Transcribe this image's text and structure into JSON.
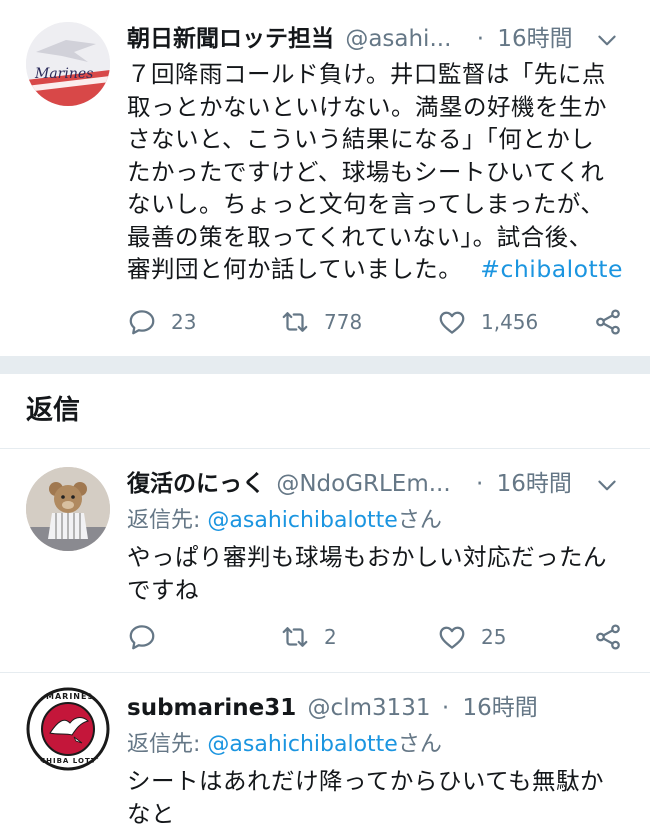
{
  "main_tweet": {
    "name": "朝日新聞ロッテ担当",
    "handle": "@asahi...",
    "separator": "·",
    "time": "16時間",
    "avatar_text": "Marines",
    "text_lines": [
      "７回降雨コールド負け。井口監督は「先に点",
      "取っとかないといけない。満塁の好機を生か",
      "さないと、こういう結果になる」「何とかし",
      "たかったですけど、球場もシートひいてくれ",
      "ないし。ちょっと文句を言ってしまったが、",
      "最善の策を取ってくれていない」。試合後、",
      "審判団と何か話していました。"
    ],
    "hashtag": "#chibalotte",
    "replies_count": "23",
    "retweets_count": "778",
    "likes_count": "1,456"
  },
  "section": {
    "title": "返信"
  },
  "reply1": {
    "name": "復活のにっく",
    "handle": "@NdoGRLEm...",
    "separator": "·",
    "time": "16時間",
    "reply_to_prefix": "返信先: ",
    "reply_to_handle": "@asahichibalotte",
    "reply_to_suffix": "さん",
    "text_lines": [
      "やっぱり審判も球場もおかしい対応だったん",
      "ですね"
    ],
    "replies_count": "",
    "retweets_count": "2",
    "likes_count": "25"
  },
  "reply2": {
    "name": "submarine31",
    "handle": "@clm3131",
    "separator": "·",
    "time": "16時間",
    "reply_to_prefix": "返信先: ",
    "reply_to_handle": "@asahichibalotte",
    "reply_to_suffix": "さん",
    "text_lines": [
      "シートはあれだけ降ってからひいても無駄か",
      "なと"
    ],
    "avatar_text_top": "MARINES",
    "avatar_text_bottom": "CHIBA LOTTE"
  },
  "colors": {
    "link": "#1b95e0",
    "secondary": "#657786",
    "divider": "#e6ecf0",
    "text": "#14171a"
  },
  "icons": [
    "reply-icon",
    "retweet-icon",
    "like-icon",
    "share-icon",
    "caret-down-icon"
  ]
}
